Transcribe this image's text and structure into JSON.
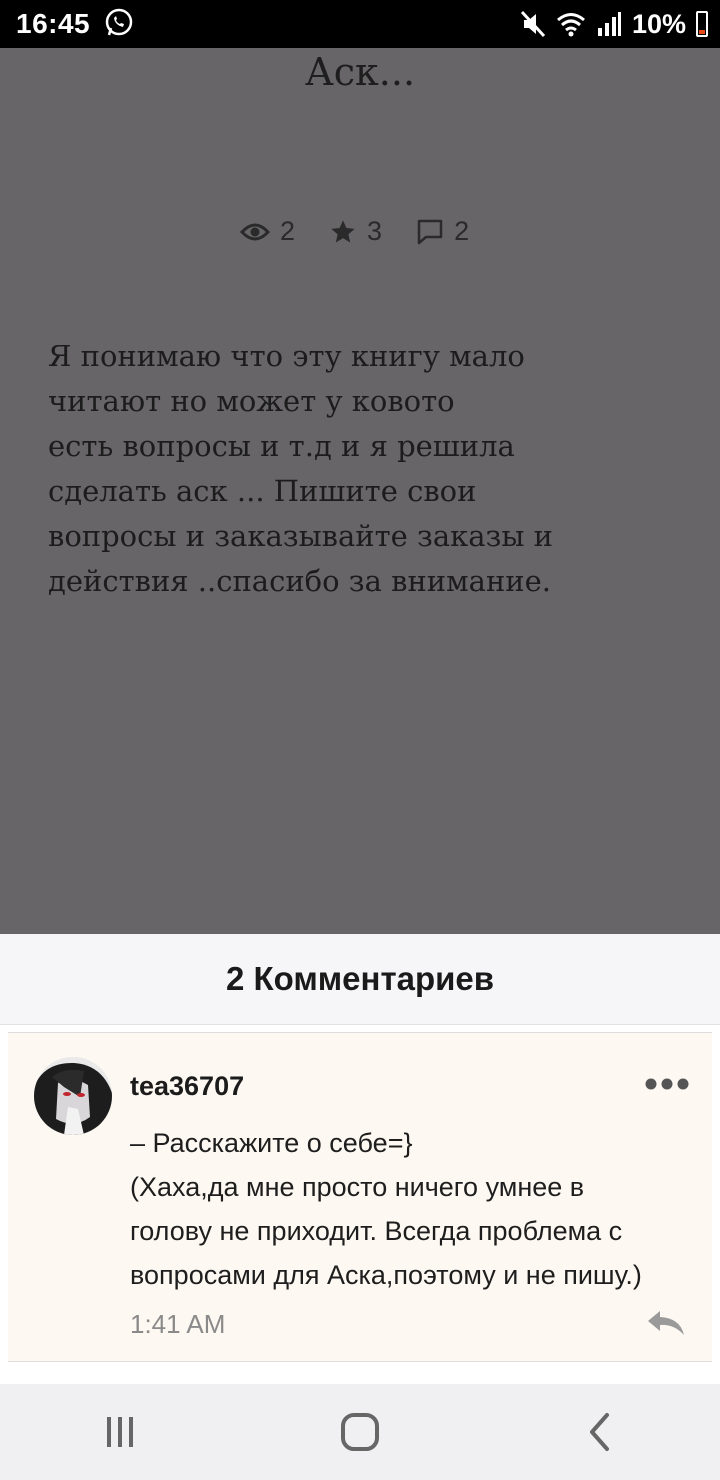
{
  "status_bar": {
    "time": "16:45",
    "battery": "10%",
    "icons": [
      "whatsapp-icon",
      "mute-icon",
      "wifi-icon",
      "signal-icon",
      "battery-icon"
    ]
  },
  "story": {
    "title": "Аск...",
    "stats": {
      "views": "2",
      "votes": "3",
      "comments": "2"
    },
    "body": "Я понимаю что эту книгу мало\nчитают но может у ковото\nесть вопросы и т.д и я решила\nсделать аск ... Пишите свои\nвопросы и заказывайте заказы и\nдействия ..спасибо за внимание."
  },
  "comments": {
    "header": "2 Комментариев",
    "items": [
      {
        "username": "tea36707",
        "text": "– Расскажите о себе=}\n(Хаха,да мне просто ничего умнее в\nголову не приходит. Всегда проблема с\nвопросами для Аска,поэтому и не пишу.)",
        "time": "1:41 AM"
      }
    ]
  },
  "navbar": {
    "buttons": [
      "recent-apps-icon",
      "home-icon",
      "back-icon"
    ]
  },
  "colors": {
    "dim_overlay": "#676568",
    "comment_bg": "#fdf8f1",
    "header_bg": "#f6f5f7"
  }
}
